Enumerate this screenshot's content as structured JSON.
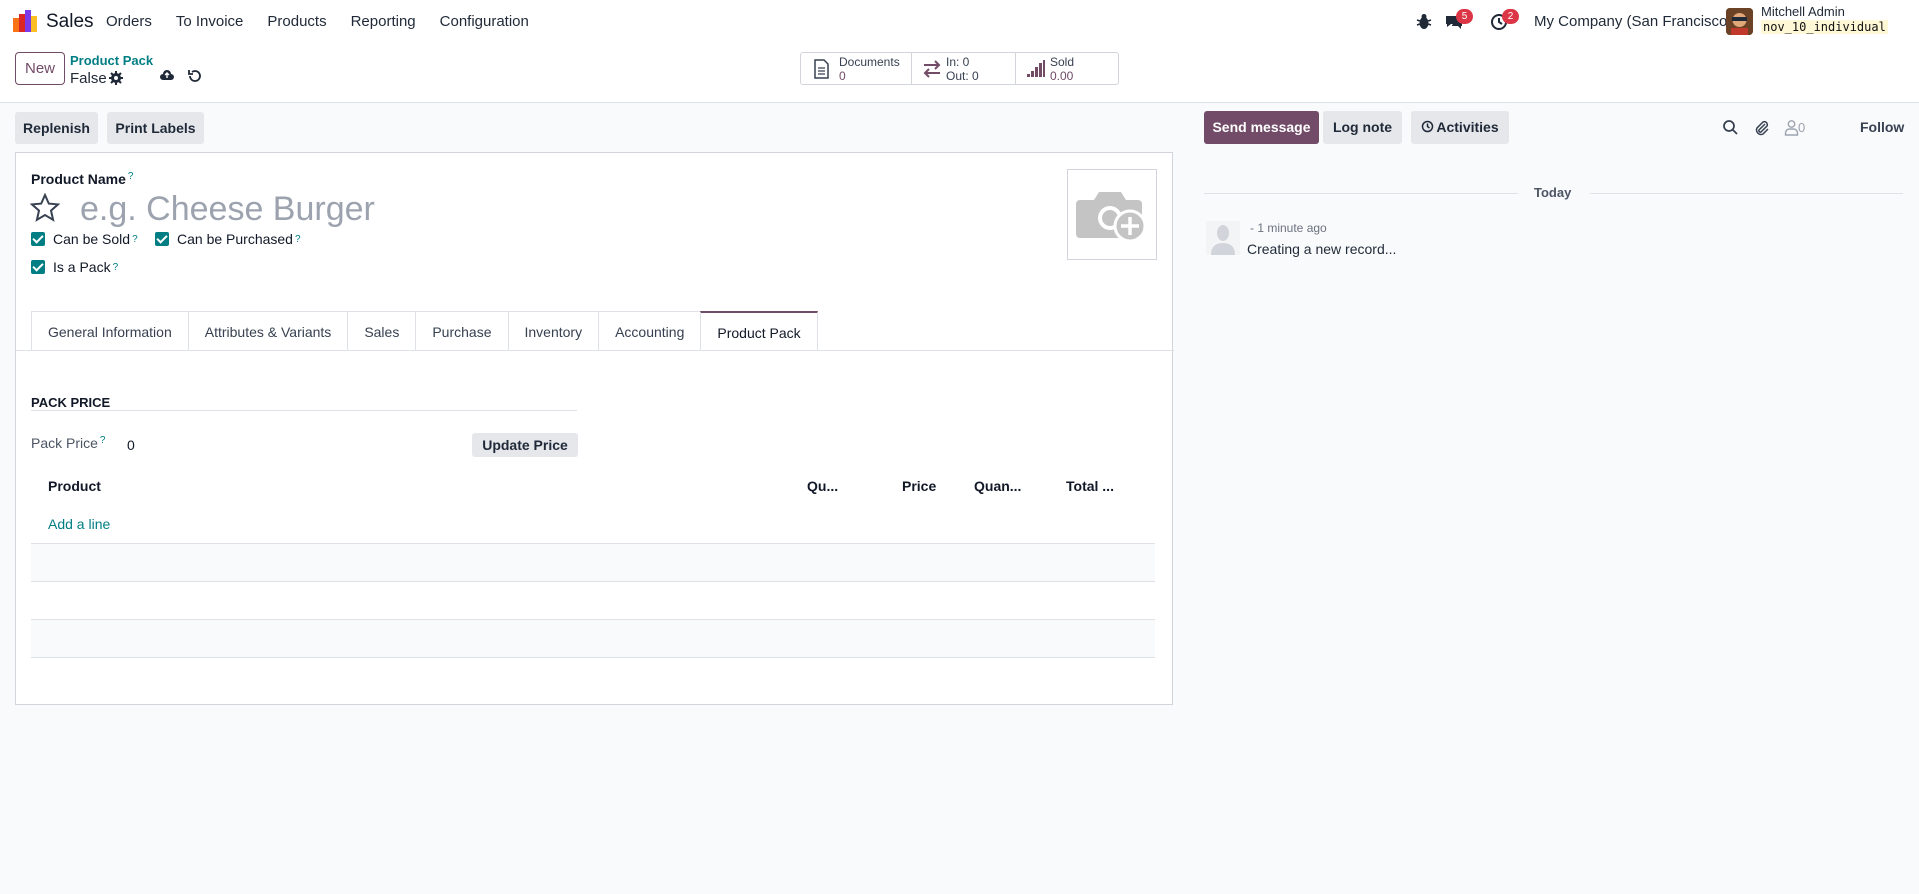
{
  "navbar": {
    "app_name": "Sales",
    "menu": [
      "Orders",
      "To Invoice",
      "Products",
      "Reporting",
      "Configuration"
    ],
    "messages_badge": "5",
    "activities_badge": "2",
    "company": "My Company (San Francisco)",
    "user_name": "Mitchell Admin",
    "db_name": "nov_10_individual",
    "icons": [
      "bug-icon",
      "chat-icon",
      "clock-icon"
    ]
  },
  "control": {
    "new_label": "New",
    "breadcrumb": "Product Pack",
    "record_name": "False",
    "smart_buttons": {
      "documents_label": "Documents",
      "documents_count": "0",
      "in_label": "In: 0",
      "out_label": "Out: 0",
      "sold_label": "Sold",
      "sold_value": "0.00"
    }
  },
  "actions": {
    "replenish": "Replenish",
    "print_labels": "Print Labels"
  },
  "form": {
    "product_name_label": "Product Name",
    "tip": "?",
    "product_name_placeholder": "e.g. Cheese Burger",
    "can_be_sold": "Can be Sold",
    "can_be_purchased": "Can be Purchased",
    "is_a_pack": "Is a Pack",
    "tabs": [
      "General Information",
      "Attributes & Variants",
      "Sales",
      "Purchase",
      "Inventory",
      "Accounting",
      "Product Pack"
    ],
    "active_tab": "Product Pack",
    "section_title": "PACK PRICE",
    "pack_price_label": "Pack Price",
    "pack_price_value": "0",
    "update_price": "Update Price",
    "table_headers": [
      "Product",
      "Qu...",
      "Price",
      "Quan...",
      "Total ..."
    ],
    "add_line": "Add a line"
  },
  "chatter": {
    "send_message": "Send message",
    "log_note": "Log note",
    "activities": "Activities",
    "followers_count": "0",
    "follow": "Follow",
    "today": "Today",
    "message_time": "- 1 minute ago",
    "message_body": "Creating a new record..."
  },
  "colors": {
    "brand": "#714b67",
    "accent": "#017e84",
    "badge": "#dc3545"
  }
}
